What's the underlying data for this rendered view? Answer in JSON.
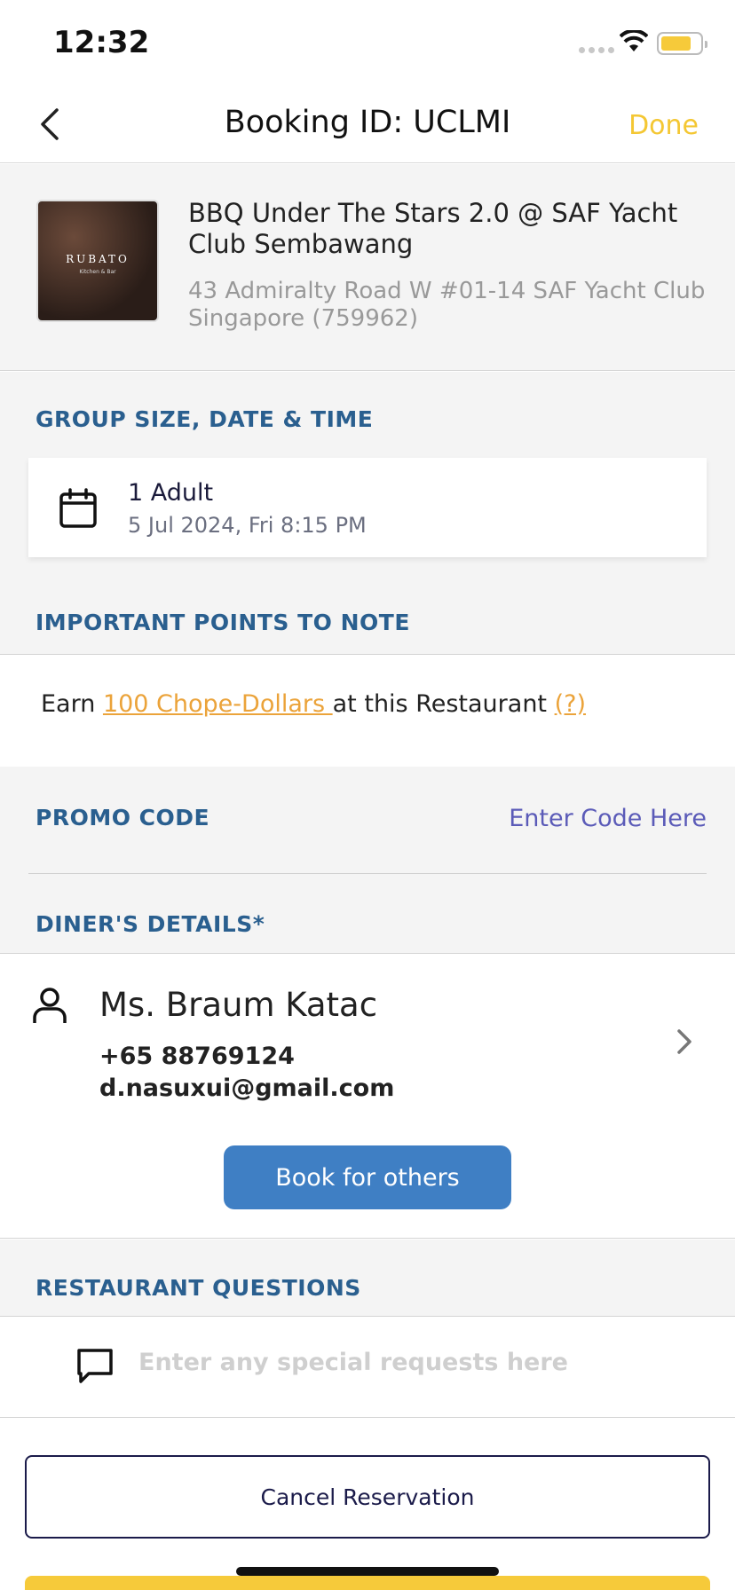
{
  "status_bar": {
    "time": "12:32"
  },
  "nav": {
    "title": "Booking ID: UCLMI",
    "done_label": "Done"
  },
  "restaurant": {
    "name": "BBQ Under The Stars 2.0 @ SAF Yacht Club Sembawang",
    "address": "43 Admiralty Road W #01-14 SAF Yacht Club Singapore (759962)",
    "thumb_logo": "RUBATO",
    "thumb_sub": "Kitchen & Bar"
  },
  "group": {
    "heading": "GROUP SIZE, DATE & TIME",
    "guests": "1 Adult",
    "datetime": "5 Jul 2024, Fri 8:15 PM"
  },
  "notes": {
    "heading": "IMPORTANT POINTS TO NOTE",
    "earn_prefix": "Earn ",
    "earn_link": "100 Chope-Dollars ",
    "earn_suffix": "at this Restaurant ",
    "help_link": "(?)"
  },
  "promo": {
    "heading": "PROMO CODE",
    "input_label": "Enter Code Here"
  },
  "diner": {
    "heading": "DINER'S DETAILS*",
    "name": "Ms. Braum Katac",
    "phone": "+65 88769124",
    "email": "d.nasuxui@gmail.com",
    "book_others_label": "Book for others"
  },
  "questions": {
    "heading": "RESTAURANT QUESTIONS",
    "placeholder": "Enter any special requests here"
  },
  "actions": {
    "cancel_label": "Cancel Reservation"
  },
  "colors": {
    "accent_yellow": "#f4c733",
    "heading_blue": "#2a5f8f",
    "button_blue": "#3f7fc4",
    "link_orange": "#eba33a",
    "navy": "#1b1b4a"
  }
}
